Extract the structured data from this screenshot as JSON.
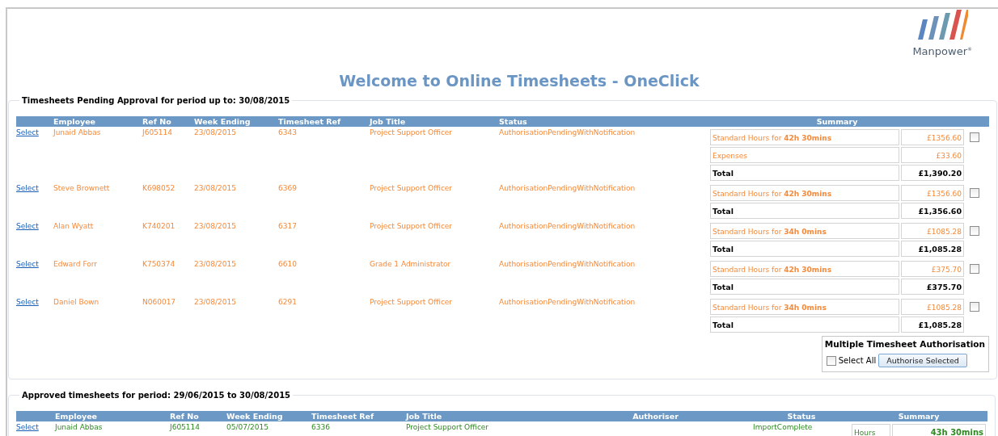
{
  "logo": {
    "text": "Manpower$^{®}$"
  },
  "title": "Welcome to Online Timesheets - OneClick",
  "pending": {
    "legend": "Timesheets Pending Approval for period up to: 30/08/2015",
    "columns": [
      "",
      "Employee",
      "Ref No",
      "Week Ending",
      "Timesheet Ref",
      "Job Title",
      "Status",
      "Summary",
      ""
    ],
    "rows": [
      {
        "link": "Select",
        "employee": "Junaid Abbas",
        "ref_no": "J605114",
        "week_ending": "23/08/2015",
        "timesheet_ref": "6343",
        "job_title": "Project Support Officer",
        "status": "AuthorisationPendingWithNotification",
        "checked": false,
        "summary": [
          {
            "kind": "line",
            "label": "Standard Hours for **42h 30mins**",
            "amount": "£1356.60"
          },
          {
            "kind": "line",
            "label": "Expenses",
            "amount": "£33.60"
          },
          {
            "kind": "total",
            "label": "Total",
            "amount": "£1,390.20"
          }
        ]
      },
      {
        "link": "Select",
        "employee": "Steve Brownett",
        "ref_no": "K698052",
        "week_ending": "23/08/2015",
        "timesheet_ref": "6369",
        "job_title": "Project Support Officer",
        "status": "AuthorisationPendingWithNotification",
        "checked": false,
        "summary": [
          {
            "kind": "line",
            "label": "Standard Hours for **42h 30mins**",
            "amount": "£1356.60"
          },
          {
            "kind": "total",
            "label": "Total",
            "amount": "£1,356.60"
          }
        ]
      },
      {
        "link": "Select",
        "employee": "Alan Wyatt",
        "ref_no": "K740201",
        "week_ending": "23/08/2015",
        "timesheet_ref": "6317",
        "job_title": "Project Support Officer",
        "status": "AuthorisationPendingWithNotification",
        "checked": false,
        "summary": [
          {
            "kind": "line",
            "label": "Standard Hours for **34h 0mins**",
            "amount": "£1085.28"
          },
          {
            "kind": "total",
            "label": "Total",
            "amount": "£1,085.28"
          }
        ]
      },
      {
        "link": "Select",
        "employee": "Edward Forr",
        "ref_no": "K750374",
        "week_ending": "23/08/2015",
        "timesheet_ref": "6610",
        "job_title": "Grade 1 Administrator",
        "status": "AuthorisationPendingWithNotification",
        "checked": false,
        "summary": [
          {
            "kind": "line",
            "label": "Standard Hours for **42h 30mins**",
            "amount": "£375.70"
          },
          {
            "kind": "total",
            "label": "Total",
            "amount": "£375.70"
          }
        ]
      },
      {
        "link": "Select",
        "employee": "Daniel Bown",
        "ref_no": "N060017",
        "week_ending": "23/08/2015",
        "timesheet_ref": "6291",
        "job_title": "Project Support Officer",
        "status": "AuthorisationPendingWithNotification",
        "checked": false,
        "summary": [
          {
            "kind": "line",
            "label": "Standard Hours for **34h 0mins**",
            "amount": "£1085.28"
          },
          {
            "kind": "total",
            "label": "Total",
            "amount": "£1,085.28"
          }
        ]
      }
    ],
    "multi": {
      "title": "Multiple Timesheet Authorisation",
      "select_all": {
        "label": "Select All",
        "checked": false
      },
      "button": "Authorise Selected"
    }
  },
  "approved": {
    "legend": "Approved timesheets for period: 29/06/2015 to 30/08/2015",
    "columns": [
      "",
      "Employee",
      "Ref No",
      "Week Ending",
      "Timesheet Ref",
      "Job Title",
      "Authoriser",
      "Status",
      "Summary"
    ],
    "rows": [
      {
        "link": "Select",
        "employee": "Junaid Abbas",
        "ref_no": "J605114",
        "week_ending": "05/07/2015",
        "timesheet_ref": "6336",
        "job_title": "Project Support Officer",
        "status": "ImportComplete",
        "summary": [
          {
            "label": "Hours",
            "value": "43h 30mins"
          }
        ]
      }
    ]
  }
}
